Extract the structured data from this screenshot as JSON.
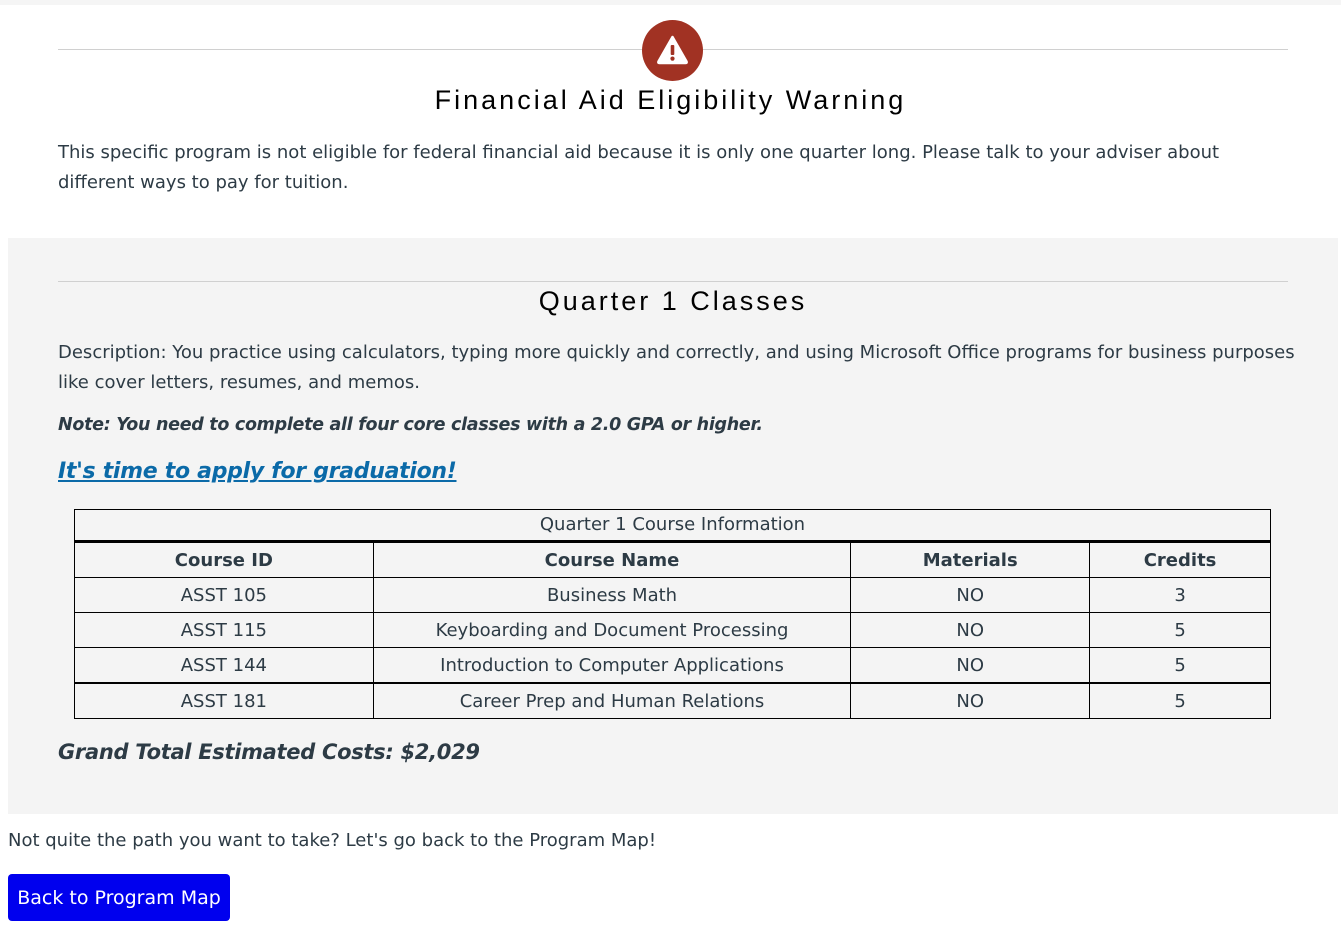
{
  "warning": {
    "icon": "warning-icon",
    "title": "Financial Aid Eligibility Warning",
    "text": "This specific program is not eligible for federal financial aid because it is only one quarter long. Please talk to your adviser about different ways to pay for tuition."
  },
  "quarter": {
    "title": "Quarter 1 Classes",
    "description": "Description: You practice using calculators, typing more quickly and correctly, and using Microsoft Office programs for business purposes like cover letters, resumes, and memos.",
    "note": "Note: You need to complete all four core classes with a 2.0 GPA or higher.",
    "graduation_link": "It's time to apply for graduation!",
    "table": {
      "caption": "Quarter 1 Course Information",
      "headers": [
        "Course ID",
        "Course Name",
        "Materials",
        "Credits"
      ],
      "rows": [
        [
          "ASST 105",
          "Business Math",
          "NO",
          "3"
        ],
        [
          "ASST 115",
          "Keyboarding and Document Processing",
          "NO",
          "5"
        ],
        [
          "ASST 144",
          "Introduction to Computer Applications",
          "NO",
          "5"
        ],
        [
          "ASST 181",
          "Career Prep and Human Relations",
          "NO",
          "5"
        ]
      ]
    },
    "grand_total": "Grand Total Estimated Costs: $2,029"
  },
  "footer": {
    "back_text": "Not quite the path you want to take? Let's go back to the Program Map!",
    "back_button_label": "Back to Program Map"
  },
  "colors": {
    "warning_icon_bg": "#a13223",
    "link": "#0b6aa8",
    "button_bg": "#0000ee",
    "section_bg": "#f4f4f4"
  }
}
